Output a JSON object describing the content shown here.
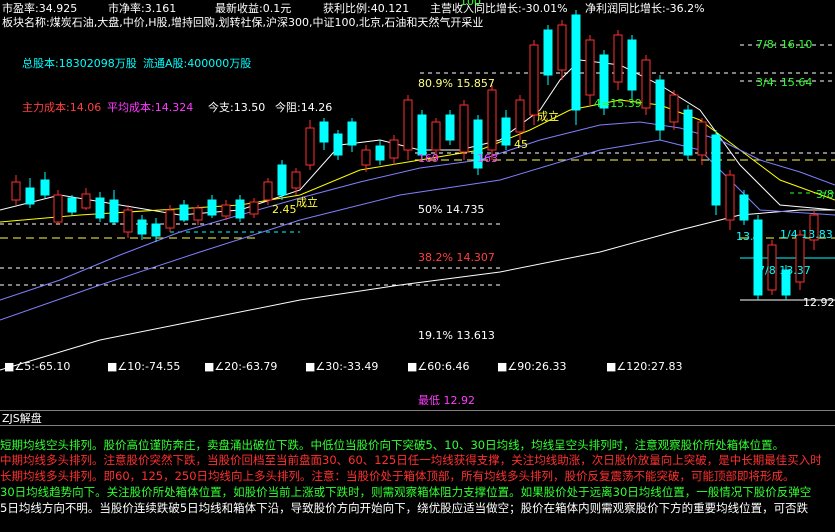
{
  "header": {
    "pe_label": "市盈率:34.925",
    "pb_label": "市净率:3.161",
    "eps_label": "最新收益:0.1元",
    "profit_ratio_label": "获利比例:40.121",
    "revenue_growth_label": "主营收入同比增长:-30.01%",
    "net_profit_growth_label": "净利润同比增长:-36.2%",
    "sector_label": "板块名称:煤炭石油,大盘,中价,H股,增持回购,划转社保,沪深300,中证100,北京,石油和天然气开采业",
    "total_shares_label": "总股本:18302098万股",
    "float_shares_label": "流通A股:400000万股",
    "main_cost_label": "主力成本:14.06",
    "avg_cost_label": "平均成本:14.324",
    "today_open_label": "今支:13.50",
    "today_resist_label": "今阻:14.26"
  },
  "levels": {
    "l_top_right": "7/8: 16.10",
    "l_34": "3/4: 15.64",
    "l_809": "80.9%  15.857",
    "l_50": "50%  14.735",
    "l_382": "38.2%  14.307",
    "l_191": "19.1%  13.613",
    "l_lowest": "最低  12.92",
    "l_right_38": "3/8",
    "l_right_price": "12.92",
    "l_right_78": "7/8 13.37",
    "l_right_14": "1/4 13.83",
    "l_right_13": "13.",
    "l_mid_1539": "4=15.39",
    "l_mid_45": "45",
    "l_left_145": "2.45",
    "l_cheng1": "成立",
    "l_cheng2": "成立",
    "l_100": "100",
    "l_169": "169",
    "l_163": "163"
  },
  "angles": [
    "∠5:-65.10",
    "∠10:-74.55",
    "∠20:-63.79",
    "∠30:-33.49",
    "∠60:6.46",
    "∠90:26.33",
    "∠120:27.83"
  ],
  "panel": {
    "title": "ZJS解盘"
  },
  "commentary": [
    "短期均线空头排列。股价高位谨防奔庄，卖盘涌出破位下跌。中低位当股价向下突破5、10、30日均线，均线呈空头排列时，注意观察股价所处箱体位置。",
    "中期均线多头排列。注意股价突然下跌，当股价回档至当前盘面30、60、125日任一均线获得支撑，关注均线助涨，次日股价放量向上突破，是中长期最佳买入时",
    "长期均线多头排列。即60，125，250日均线向上多头排列。注意：当股价处于箱体顶部，所有均线多头排列，股价反复震荡不能突破，可能顶部即将形成。",
    "30日均线趋势向下。关注股价所处箱体位置，如股价当前上涨或下跌时，则需观察箱体阻力支撑位置。如果股价处于远离30日均线位置，一般情况下股价反弹空",
    "5日均线方向不明。当股价连续跌破5日均线和箱体下沿，导致股价方向开始向下，绕优股应适当做空；股价在箱体内则需观察股价下方的重要均线位置，可否跌"
  ],
  "colors": {
    "up_candle": "#ff3030",
    "down_candle": "#00ffff",
    "ma_white": "#ffffff",
    "ma_yellow": "#ffff00",
    "ma_purple": "#8080ff",
    "comment_green": "#30ff30",
    "comment_red": "#ff3030"
  }
}
